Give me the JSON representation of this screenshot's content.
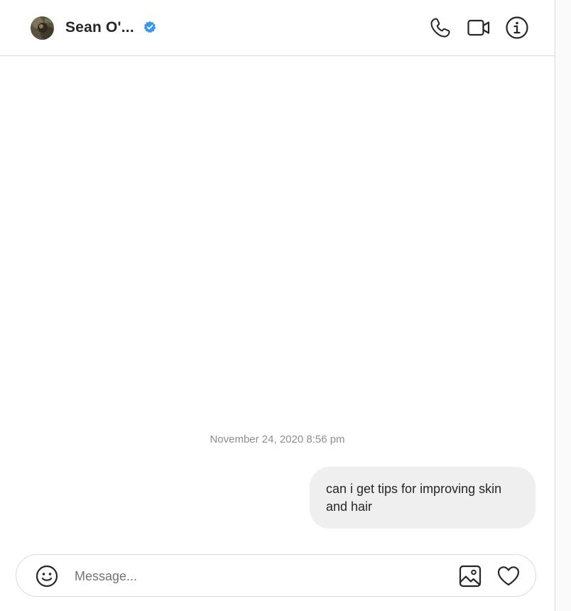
{
  "header": {
    "username": "Sean O'...",
    "verified": true,
    "avatar_icon": "user-avatar",
    "actions": [
      {
        "name": "audio-call",
        "icon": "phone-icon"
      },
      {
        "name": "video-call",
        "icon": "video-camera-icon"
      },
      {
        "name": "conversation-info",
        "icon": "info-icon"
      }
    ]
  },
  "thread": {
    "timestamp": "November 24, 2020 8:56 pm",
    "messages": [
      {
        "from": "me",
        "text": "can i get tips for improving skin and hair"
      }
    ]
  },
  "composer": {
    "placeholder": "Message...",
    "value": "",
    "icons": [
      "emoji-icon",
      "image-icon",
      "heart-icon"
    ]
  },
  "colors": {
    "verified_badge": "#3897f0",
    "bubble_bg": "#efefef",
    "border": "#dbdbdb",
    "muted_text": "#8e8e8e"
  }
}
